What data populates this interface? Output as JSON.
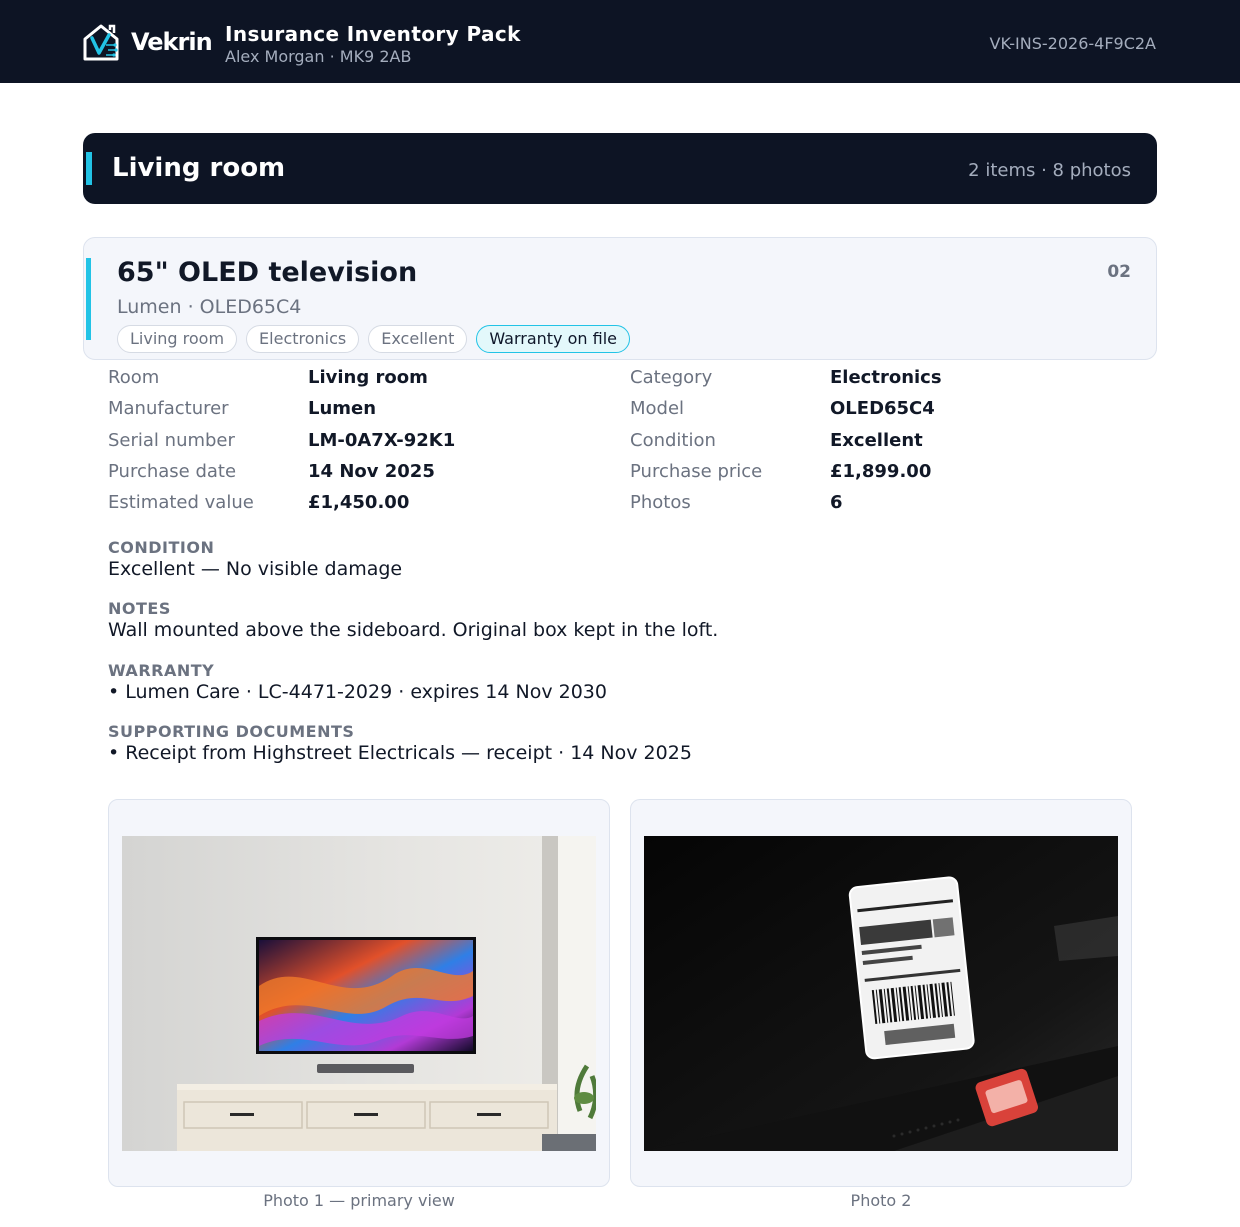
{
  "header": {
    "brand": "Vekrin",
    "title": "Insurance Inventory Pack",
    "subtitle": "Alex Morgan · MK9 2AB",
    "reference": "VK-INS-2026-4F9C2A"
  },
  "room": {
    "name": "Living room",
    "meta": "2 items · 8 photos"
  },
  "item": {
    "title": "65\" OLED television",
    "subtitle": "Lumen · OLED65C4",
    "number": "02",
    "tags": [
      "Living room",
      "Electronics",
      "Excellent",
      "Warranty on file"
    ]
  },
  "details": {
    "left": [
      {
        "label": "Room",
        "value": "Living room"
      },
      {
        "label": "Manufacturer",
        "value": "Lumen"
      },
      {
        "label": "Serial number",
        "value": "LM-0A7X-92K1"
      },
      {
        "label": "Purchase date",
        "value": "14 Nov 2025"
      },
      {
        "label": "Estimated value",
        "value": "£1,450.00"
      }
    ],
    "right": [
      {
        "label": "Category",
        "value": "Electronics"
      },
      {
        "label": "Model",
        "value": "OLED65C4"
      },
      {
        "label": "Condition",
        "value": "Excellent"
      },
      {
        "label": "Purchase price",
        "value": "£1,899.00"
      },
      {
        "label": "Photos",
        "value": "6"
      }
    ]
  },
  "sections": {
    "condition": {
      "label": "CONDITION",
      "text": "Excellent — No visible damage"
    },
    "notes": {
      "label": "NOTES",
      "text": "Wall mounted above the sideboard. Original box kept in the loft."
    },
    "warranty": {
      "label": "WARRANTY",
      "text": "• Lumen Care · LC-4471-2029 · expires 14 Nov 2030"
    },
    "documents": {
      "label": "SUPPORTING DOCUMENTS",
      "text": "• Receipt from Highstreet Electricals — receipt · 14 Nov 2025"
    }
  },
  "photos": [
    {
      "caption": "Photo 1 — primary view"
    },
    {
      "caption": "Photo 2"
    }
  ],
  "colors": {
    "navy": "#0d1424",
    "accent": "#22c3e6",
    "card_bg": "#f4f6fb",
    "muted_text": "#6b7280"
  }
}
